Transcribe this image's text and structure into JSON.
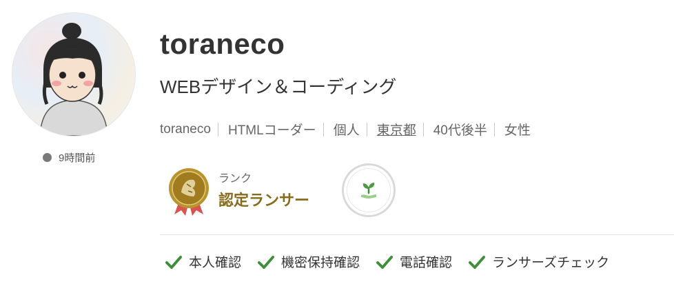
{
  "profile": {
    "username": "toraneco",
    "tagline": "WEBデザイン＆コーディング",
    "last_seen": "9時間前",
    "meta": {
      "handle": "toraneco",
      "job": "HTMLコーダー",
      "type": "個人",
      "location": "東京都",
      "age": "40代後半",
      "gender": "女性"
    }
  },
  "rank": {
    "label": "ランク",
    "value": "認定ランサー"
  },
  "checks": [
    {
      "label": "本人確認"
    },
    {
      "label": "機密保持確認"
    },
    {
      "label": "電話確認"
    },
    {
      "label": "ランサーズチェック"
    }
  ],
  "colors": {
    "rank_text": "#876b1c",
    "check_green": "#3f8f3a",
    "presence_dot": "#7a7a7a"
  },
  "icons": {
    "rank_medal": "rank-medal-icon",
    "sprout_badge": "sprout-icon",
    "check": "check-icon"
  }
}
